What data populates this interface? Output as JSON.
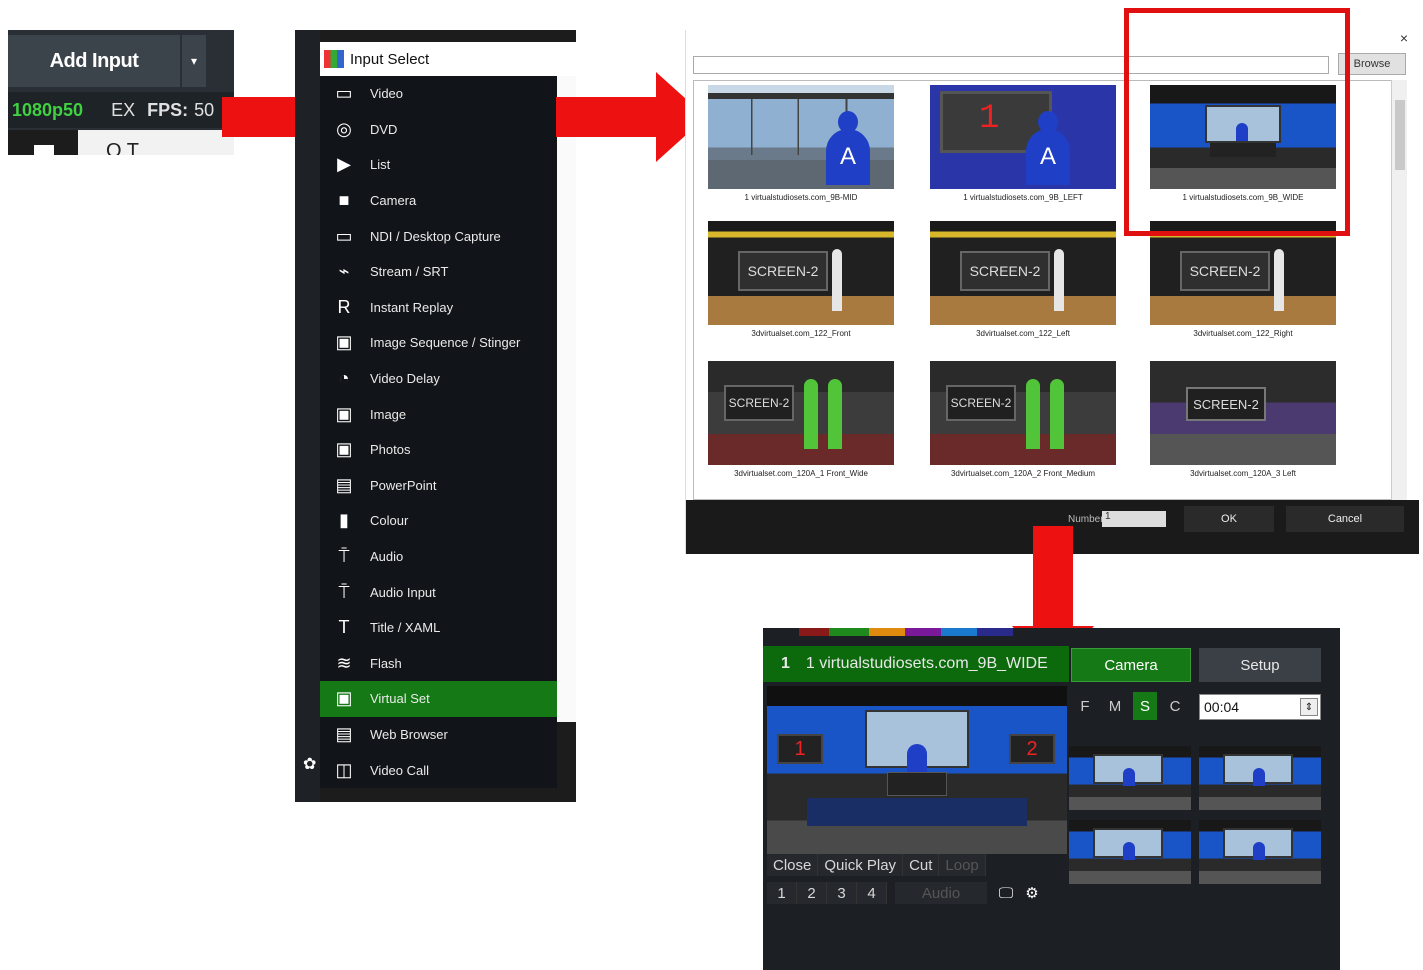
{
  "toolbar": {
    "add_input_label": "Add Input",
    "dropdown_glyph": "▾",
    "resolution": "1080p50",
    "ex_label": "EX",
    "fps_label": "FPS:",
    "fps_value": "50",
    "search_text": "O  T",
    "colors": {
      "resolution": "#3fd13f"
    }
  },
  "input_select": {
    "title": "Input Select",
    "items": [
      {
        "label": "Video",
        "icon": "film-icon"
      },
      {
        "label": "DVD",
        "icon": "disc-icon"
      },
      {
        "label": "List",
        "icon": "list-play-icon"
      },
      {
        "label": "Camera",
        "icon": "camera-icon"
      },
      {
        "label": "NDI / Desktop Capture",
        "icon": "monitor-icon"
      },
      {
        "label": "Stream / SRT",
        "icon": "antenna-icon"
      },
      {
        "label": "Instant Replay",
        "icon": "replay-icon"
      },
      {
        "label": "Image Sequence / Stinger",
        "icon": "image-sequence-icon"
      },
      {
        "label": "Video Delay",
        "icon": "stopwatch-icon"
      },
      {
        "label": "Image",
        "icon": "image-icon"
      },
      {
        "label": "Photos",
        "icon": "photos-icon"
      },
      {
        "label": "PowerPoint",
        "icon": "presentation-icon"
      },
      {
        "label": "Colour",
        "icon": "gradient-icon"
      },
      {
        "label": "Audio",
        "icon": "microphone-icon"
      },
      {
        "label": "Audio Input",
        "icon": "audio-input-icon"
      },
      {
        "label": "Title / XAML",
        "icon": "title-icon"
      },
      {
        "label": "Flash",
        "icon": "flash-icon"
      },
      {
        "label": "Virtual Set",
        "icon": "virtual-set-icon",
        "selected": true
      },
      {
        "label": "Web Browser",
        "icon": "browser-icon"
      },
      {
        "label": "Video Call",
        "icon": "video-call-icon"
      }
    ],
    "selected_color": "#157a15"
  },
  "browser_dialog": {
    "close_glyph": "×",
    "browse_label": "Browse",
    "thumbnails": [
      {
        "caption": "1 virtualstudiosets.com_9B-MID",
        "scene": "a"
      },
      {
        "caption": "1 virtualstudiosets.com_9B_LEFT",
        "scene": "b"
      },
      {
        "caption": "1 virtualstudiosets.com_9B_WIDE",
        "scene": "c"
      },
      {
        "caption": "3dvirtualset.com_122_Front",
        "scene": "d",
        "screen_text": "SCREEN-2"
      },
      {
        "caption": "3dvirtualset.com_122_Left",
        "scene": "d",
        "screen_text": "SCREEN-2"
      },
      {
        "caption": "3dvirtualset.com_122_Right",
        "scene": "d",
        "screen_text": "SCREEN-2"
      },
      {
        "caption": "3dvirtualset.com_120A_1 Front_Wide",
        "scene": "e",
        "screen_text": "SCREEN-2"
      },
      {
        "caption": "3dvirtualset.com_120A_2 Front_Medium",
        "scene": "e",
        "screen_text": "SCREEN-2"
      },
      {
        "caption": "3dvirtualset.com_120A_3 Left",
        "scene": "f",
        "screen_text": "SCREEN-2"
      }
    ],
    "number_label": "Number",
    "number_value": "1",
    "ok_label": "OK",
    "cancel_label": "Cancel",
    "highlight_color": "#e01010"
  },
  "input_panel": {
    "number": "1",
    "title": "1 virtualstudiosets.com_9B_WIDE",
    "camera_label": "Camera",
    "setup_label": "Setup",
    "monitor_left": "1",
    "monitor_right": "2",
    "modes": [
      "F",
      "M",
      "S",
      "C"
    ],
    "active_mode": "S",
    "time_value": "00:04",
    "controls_row1": [
      "Close",
      "Quick Play",
      "Cut",
      "Loop"
    ],
    "controls_row2_numbers": [
      "1",
      "2",
      "3",
      "4"
    ],
    "audio_label": "Audio",
    "monitor_icon": "monitor-icon",
    "gear_icon": "gear-icon",
    "tab_colors": [
      "#8a1a1a",
      "#1e8a1e",
      "#e08a10",
      "#7a1a9a",
      "#1a7ad0",
      "#2a2a8a"
    ]
  }
}
